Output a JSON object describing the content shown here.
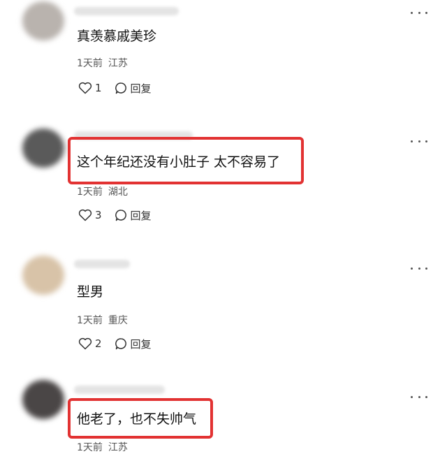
{
  "comments": [
    {
      "content": "真羡慕戚美珍",
      "time": "1天前",
      "location": "江苏",
      "likes": "1",
      "reply_label": "回复",
      "highlighted": false,
      "avatar_color": "#b9b3ae"
    },
    {
      "content": "这个年纪还没有小肚子 太不容易了",
      "time": "1天前",
      "location": "湖北",
      "likes": "3",
      "reply_label": "回复",
      "highlighted": true,
      "avatar_color": "#5a5a5a"
    },
    {
      "content": "型男",
      "time": "1天前",
      "location": "重庆",
      "likes": "2",
      "reply_label": "回复",
      "highlighted": false,
      "avatar_color": "#d8c3a8"
    },
    {
      "content": "他老了，也不失帅气",
      "time": "1天前",
      "location": "江苏",
      "likes": "",
      "reply_label": "",
      "highlighted": true,
      "avatar_color": "#4a4646"
    }
  ],
  "colors": {
    "highlight_border": "#e23232"
  }
}
